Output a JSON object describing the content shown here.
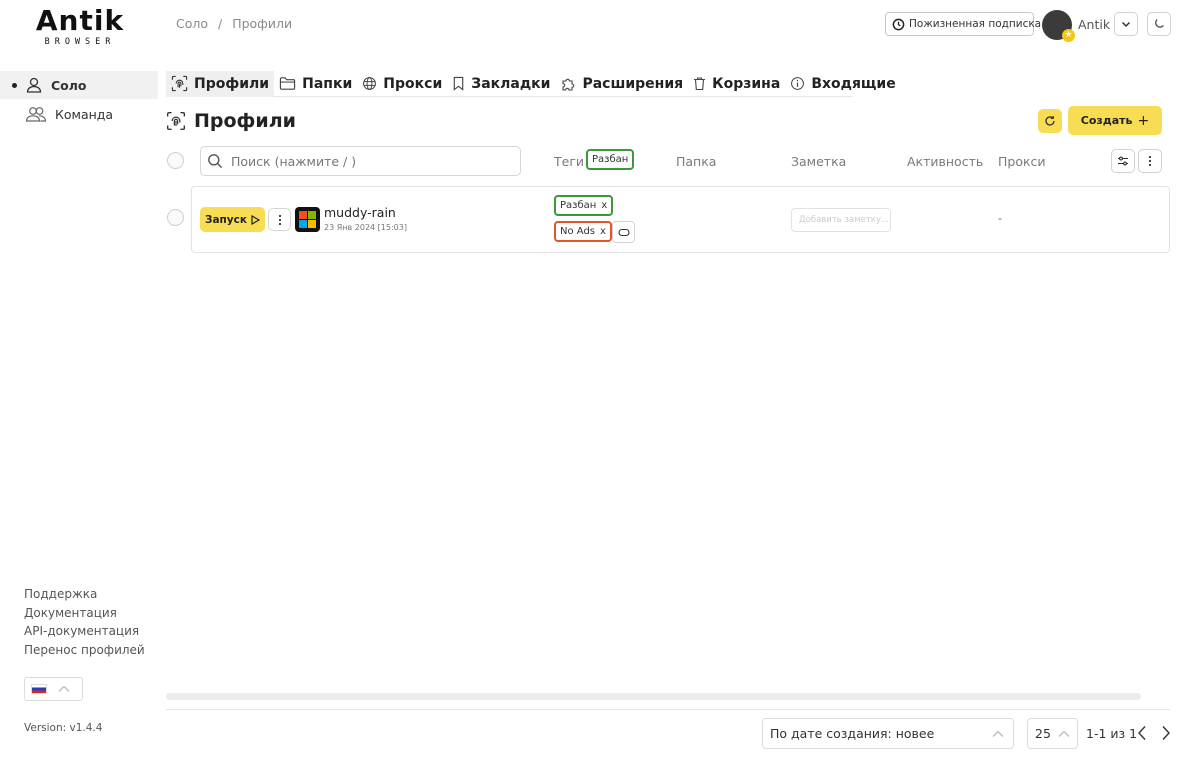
{
  "logo": {
    "word": "Antik",
    "sub": "BROWSER"
  },
  "breadcrumb": {
    "root": "Соло",
    "sep": "/",
    "current": "Профили"
  },
  "header": {
    "subscription": "Пожизненная подписка",
    "username": "Antik"
  },
  "sidebar": {
    "items": [
      {
        "label": "Соло",
        "icon": "user-icon",
        "active": true
      },
      {
        "label": "Команда",
        "icon": "team-icon",
        "active": false
      }
    ],
    "links": [
      "Поддержка",
      "Документация",
      "API-документация",
      "Перенос профилей"
    ],
    "version": "Version: v1.4.4"
  },
  "nav": {
    "tabs": [
      {
        "label": "Профили",
        "icon": "fingerprint-icon"
      },
      {
        "label": "Папки",
        "icon": "folder-icon"
      },
      {
        "label": "Прокси",
        "icon": "globe-icon"
      },
      {
        "label": "Закладки",
        "icon": "bookmark-icon"
      },
      {
        "label": "Расширения",
        "icon": "puzzle-icon"
      },
      {
        "label": "Корзина",
        "icon": "trash-icon"
      },
      {
        "label": "Входящие",
        "icon": "info-icon"
      }
    ]
  },
  "page": {
    "title": "Профили",
    "create_label": "Создать",
    "search_placeholder": "Поиск (нажмите / )"
  },
  "columns": {
    "tags": "Теги",
    "tag_filter": "Разбан",
    "folder": "Папка",
    "note": "Заметка",
    "activity": "Активность",
    "proxy": "Прокси"
  },
  "profile": {
    "launch_label": "Запуск",
    "name": "muddy-rain",
    "date": "23 Янв 2024 [15:03]",
    "tags": [
      {
        "label": "Разбан",
        "remove": "x",
        "color": "#3a9a3a"
      },
      {
        "label": "No Ads",
        "remove": "x",
        "color": "#e0582a"
      }
    ],
    "note_placeholder": "Добавить заметку...",
    "proxy": "-"
  },
  "footer": {
    "sort": "По дате создания: новее",
    "per_page": "25",
    "range": "1-1 из 1"
  }
}
